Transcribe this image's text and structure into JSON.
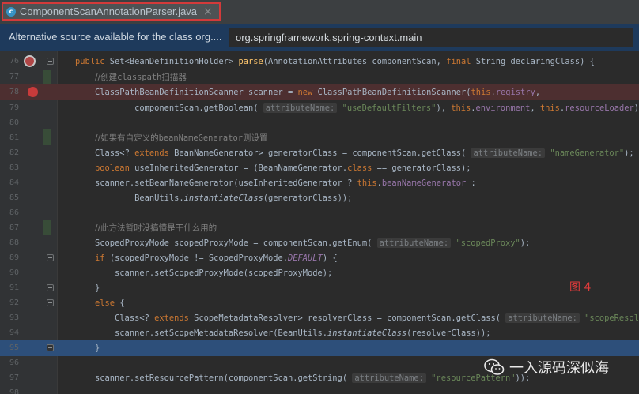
{
  "tab": {
    "label": "ComponentScanAnnotationParser.java",
    "icon": "java-class-icon",
    "close": "×"
  },
  "notice": {
    "text": "Alternative source available for the class org....",
    "selected_source": "org.springframework.spring-context.main"
  },
  "lines": [
    {
      "n": "76"
    },
    {
      "n": "77"
    },
    {
      "n": "78"
    },
    {
      "n": "79"
    },
    {
      "n": "80"
    },
    {
      "n": "81"
    },
    {
      "n": "82"
    },
    {
      "n": "83"
    },
    {
      "n": "84"
    },
    {
      "n": "85"
    },
    {
      "n": "86"
    },
    {
      "n": "87"
    },
    {
      "n": "88"
    },
    {
      "n": "89"
    },
    {
      "n": "90"
    },
    {
      "n": "91"
    },
    {
      "n": "92"
    },
    {
      "n": "93"
    },
    {
      "n": "94"
    },
    {
      "n": "95"
    },
    {
      "n": "96"
    },
    {
      "n": "97"
    },
    {
      "n": "98"
    }
  ],
  "code": {
    "l76_public": "public ",
    "l76_set": "Set<BeanDefinitionHolder> ",
    "l76_parse": "parse",
    "l76_args1": "(AnnotationAttributes componentScan, ",
    "l76_final": "final ",
    "l76_args2": "String declaringClass) {",
    "l77_comment_a": "//创建",
    "l77_comment_b": "classpath",
    "l77_comment_c": "扫描器",
    "l78_a": "ClassPathBeanDefinitionScanner scanner = ",
    "l78_new": "new ",
    "l78_b": "ClassPathBeanDefinitionScanner(",
    "l78_this": "this",
    "l78_c": ".",
    "l78_registry": "registry",
    "l78_d": ",",
    "l79_a": "componentScan.getBoolean( ",
    "l79_hint": "attributeName:",
    "l79_str": " \"useDefaultFilters\"",
    "l79_b": "), ",
    "l79_this1": "this",
    "l79_c": ".",
    "l79_env": "environment",
    "l79_d": ", ",
    "l79_this2": "this",
    "l79_e": ".",
    "l79_rl": "resourceLoader",
    "l79_f": ");",
    "l81_comment_a": "//如果有自定义的",
    "l81_comment_b": "beanNameGenerator",
    "l81_comment_c": "则设置",
    "l82_a": "Class<? ",
    "l82_extends": "extends ",
    "l82_b": "BeanNameGenerator> generatorClass = componentScan.getClass( ",
    "l82_hint": "attributeName:",
    "l82_str": " \"nameGenerator\"",
    "l82_c": ");",
    "l83_boolean": "boolean ",
    "l83_a": "useInheritedGenerator = (BeanNameGenerator.",
    "l83_class": "class ",
    "l83_b": "== generatorClass);",
    "l84_a": "scanner.setBeanNameGenerator(useInheritedGenerator ? ",
    "l84_this": "this",
    "l84_b": ".",
    "l84_bng": "beanNameGenerator",
    "l84_c": " :",
    "l85_a": "BeanUtils.",
    "l85_inst": "instantiateClass",
    "l85_b": "(generatorClass));",
    "l87_comment_a": "//此方法暂时没搞懂是干什么用的",
    "l88_a": "ScopedProxyMode scopedProxyMode = componentScan.getEnum( ",
    "l88_hint": "attributeName:",
    "l88_str": " \"scopedProxy\"",
    "l88_b": ");",
    "l89_if": "if ",
    "l89_a": "(scopedProxyMode != ScopedProxyMode.",
    "l89_default": "DEFAULT",
    "l89_b": ") {",
    "l90_a": "scanner.setScopedProxyMode(scopedProxyMode);",
    "l91_a": "}",
    "l92_else": "else ",
    "l92_a": "{",
    "l93_a": "Class<? ",
    "l93_extends": "extends ",
    "l93_b": "ScopeMetadataResolver> resolverClass = componentScan.getClass( ",
    "l93_hint": "attributeName:",
    "l93_str": " \"scopeResolver\"",
    "l93_c": ");",
    "l94_a": "scanner.setScopeMetadataResolver(BeanUtils.",
    "l94_inst": "instantiateClass",
    "l94_b": "(resolverClass));",
    "l95_a": "}",
    "l97_a": "scanner.setResourcePattern(componentScan.getString( ",
    "l97_hint": "attributeName:",
    "l97_str": " \"resourcePattern\"",
    "l97_b": "));"
  },
  "figure_label": "图  4",
  "watermark": {
    "icon": "wechat-icon",
    "text": "一入源码深似海"
  },
  "colors": {
    "keyword": "#cc7832",
    "string": "#6a8759",
    "comment": "#808080",
    "field": "#9876aa",
    "method": "#ffc66d",
    "breakpoint": "#c93b3b",
    "tab_highlight": "#d33a3a",
    "figure_label": "#e23b3b"
  }
}
